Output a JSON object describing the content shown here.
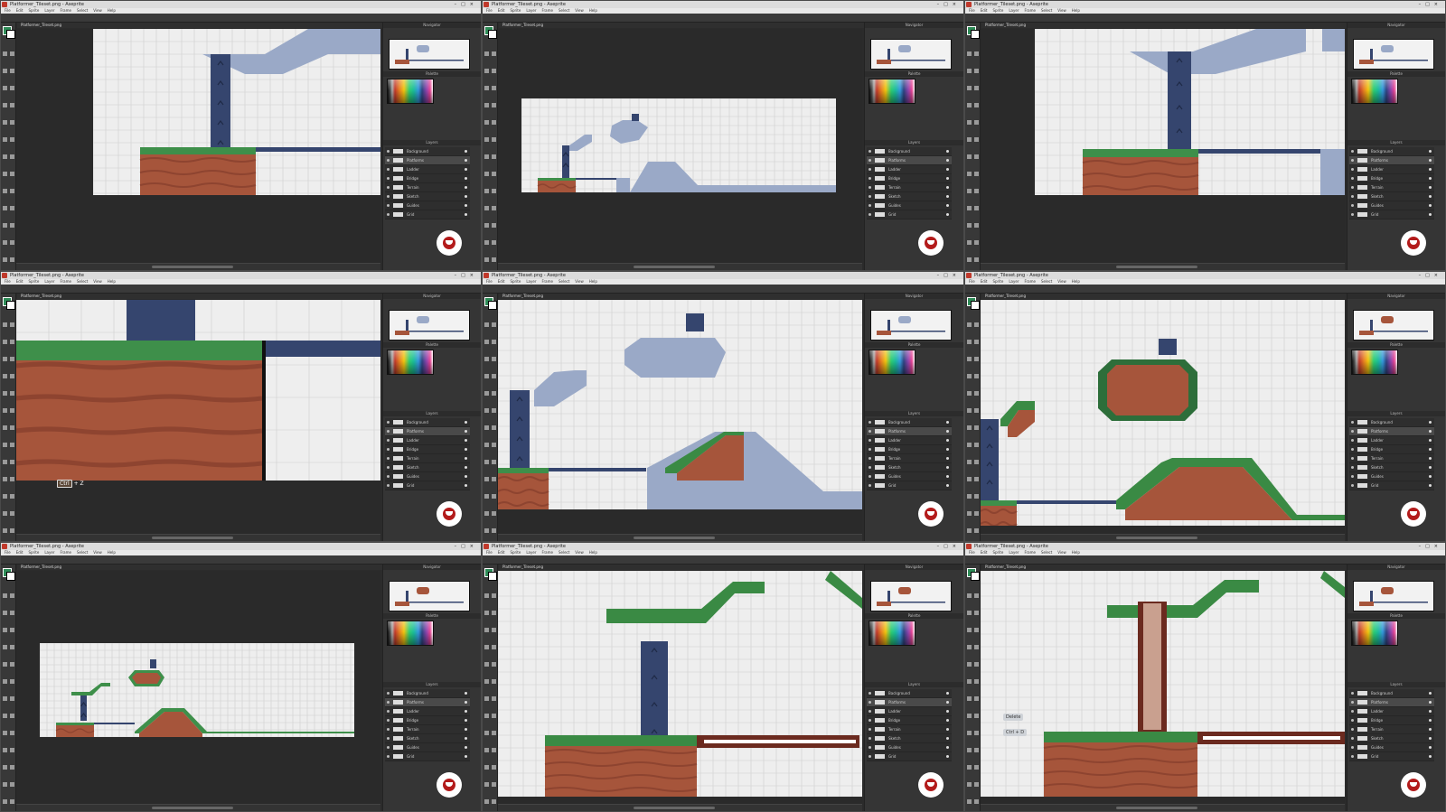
{
  "app": {
    "window_title": "Platformer_Tileset.png - Aseprite",
    "menu": [
      "File",
      "Edit",
      "Sprite",
      "Layer",
      "Frame",
      "Select",
      "View",
      "Help"
    ],
    "canvas_tab": "Platformer_Tileset.png",
    "panels": [
      "Navigator",
      "Palette",
      "Layers"
    ],
    "colors": {
      "bg_fill": "#eeeeee",
      "grid": "#cfcfcf",
      "placeholder": "#9aa9c7",
      "dark_blue": "#35456e",
      "grass": "#3e8f4a",
      "dirt": "#a6553b",
      "track": "#6b2a1f",
      "chrome": "#2b2b2b"
    }
  },
  "layers": [
    {
      "name": "Background",
      "visible": true
    },
    {
      "name": "Platforms",
      "visible": true,
      "active": true
    },
    {
      "name": "Ladder",
      "visible": true
    },
    {
      "name": "Bridge",
      "visible": true
    },
    {
      "name": "Terrain",
      "visible": true
    },
    {
      "name": "Sketch",
      "visible": true
    },
    {
      "name": "Guides",
      "visible": true
    },
    {
      "name": "Grid",
      "visible": true
    }
  ],
  "overlays": {
    "ctrl_z_key": "Ctrl",
    "ctrl_z_suffix": "+ Z",
    "delete_tip": "Delete",
    "ctrl_d_tip": "Ctrl + D"
  },
  "logo_icon": "channel-logo-icon"
}
